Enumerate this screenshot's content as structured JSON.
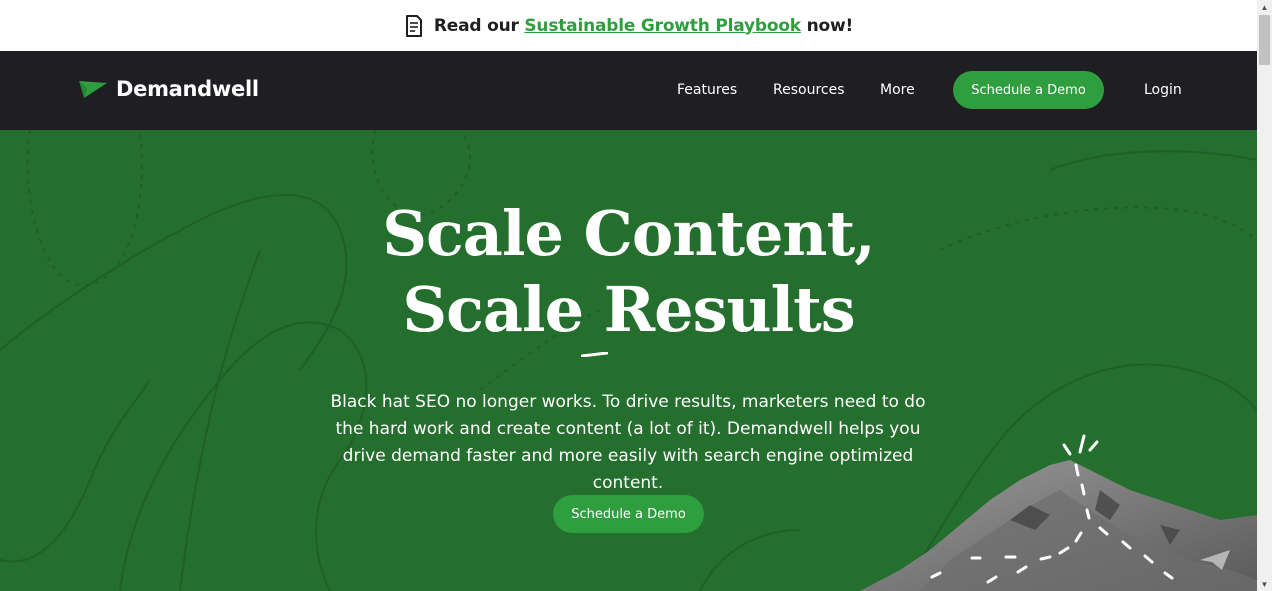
{
  "announcement": {
    "prefix": "Read our",
    "link": "Sustainable Growth Playbook",
    "suffix": "now!"
  },
  "nav": {
    "brand": "Demandwell",
    "links": [
      "Features",
      "Resources",
      "More"
    ],
    "cta": "Schedule a Demo",
    "login": "Login"
  },
  "hero": {
    "title_line1": "Scale Content,",
    "title_line2": "Scale Results",
    "description": "Black hat SEO no longer works. To drive results, marketers need to do the hard work and create content (a lot of it). Demandwell helps you drive demand faster and more easily with search engine optimized content.",
    "cta": "Schedule a Demo"
  },
  "colors": {
    "brand_green": "#2e9e3f",
    "hero_green": "#246e2e",
    "nav_dark": "#1f1e22"
  }
}
